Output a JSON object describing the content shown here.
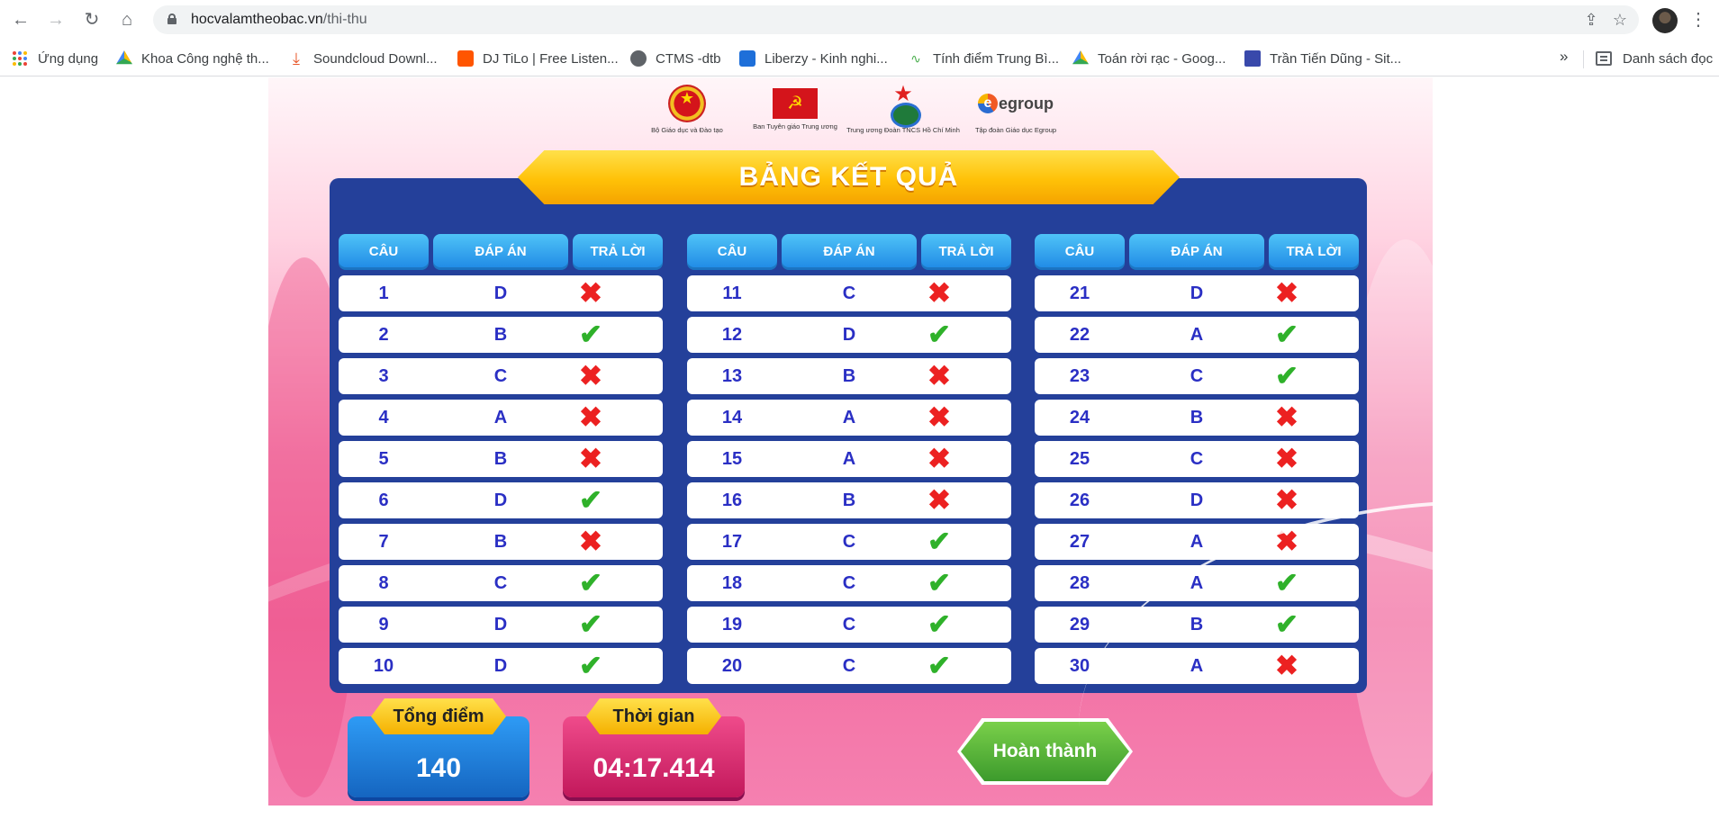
{
  "browser": {
    "url_domain": "hocvalamtheobac.vn",
    "url_path": "/thi-thu",
    "bookmarks": [
      {
        "label": "Ứng dụng",
        "icon": "apps-grid-icon"
      },
      {
        "label": "Khoa Công nghệ th...",
        "icon": "google-drive-icon"
      },
      {
        "label": "Soundcloud Downl...",
        "icon": "download-icon"
      },
      {
        "label": "DJ TiLo | Free Listen...",
        "icon": "soundcloud-icon"
      },
      {
        "label": "CTMS -dtb",
        "icon": "globe-icon"
      },
      {
        "label": "Liberzy - Kinh nghi...",
        "icon": "liberzy-icon"
      },
      {
        "label": "Tính điểm Trung Bì...",
        "icon": "calculator-icon"
      },
      {
        "label": "Toán rời rạc - Goog...",
        "icon": "google-drive-icon"
      },
      {
        "label": "Trần Tiến Dũng - Sit...",
        "icon": "sites-icon"
      }
    ],
    "more_label": "»",
    "reading_list_label": "Danh sách đọc"
  },
  "logos": [
    {
      "caption": "Bộ Giáo dục và Đào tạo"
    },
    {
      "caption": "Ban Tuyên giáo Trung ương"
    },
    {
      "caption": "Trung ương Đoàn TNCS Hồ Chí Minh"
    },
    {
      "caption": "Tập đoàn Giáo dục Egroup",
      "text": "egroup"
    }
  ],
  "results": {
    "title": "BẢNG KẾT QUẢ",
    "headers": {
      "question": "CÂU",
      "answer": "ĐÁP ÁN",
      "response": "TRẢ LỜI"
    },
    "rows": [
      {
        "q": "1",
        "a": "D",
        "correct": false
      },
      {
        "q": "2",
        "a": "B",
        "correct": true
      },
      {
        "q": "3",
        "a": "C",
        "correct": false
      },
      {
        "q": "4",
        "a": "A",
        "correct": false
      },
      {
        "q": "5",
        "a": "B",
        "correct": false
      },
      {
        "q": "6",
        "a": "D",
        "correct": true
      },
      {
        "q": "7",
        "a": "B",
        "correct": false
      },
      {
        "q": "8",
        "a": "C",
        "correct": true
      },
      {
        "q": "9",
        "a": "D",
        "correct": true
      },
      {
        "q": "10",
        "a": "D",
        "correct": true
      },
      {
        "q": "11",
        "a": "C",
        "correct": false
      },
      {
        "q": "12",
        "a": "D",
        "correct": true
      },
      {
        "q": "13",
        "a": "B",
        "correct": false
      },
      {
        "q": "14",
        "a": "A",
        "correct": false
      },
      {
        "q": "15",
        "a": "A",
        "correct": false
      },
      {
        "q": "16",
        "a": "B",
        "correct": false
      },
      {
        "q": "17",
        "a": "C",
        "correct": true
      },
      {
        "q": "18",
        "a": "C",
        "correct": true
      },
      {
        "q": "19",
        "a": "C",
        "correct": true
      },
      {
        "q": "20",
        "a": "C",
        "correct": true
      },
      {
        "q": "21",
        "a": "D",
        "correct": false
      },
      {
        "q": "22",
        "a": "A",
        "correct": true
      },
      {
        "q": "23",
        "a": "C",
        "correct": true
      },
      {
        "q": "24",
        "a": "B",
        "correct": false
      },
      {
        "q": "25",
        "a": "C",
        "correct": false
      },
      {
        "q": "26",
        "a": "D",
        "correct": false
      },
      {
        "q": "27",
        "a": "A",
        "correct": false
      },
      {
        "q": "28",
        "a": "A",
        "correct": true
      },
      {
        "q": "29",
        "a": "B",
        "correct": true
      },
      {
        "q": "30",
        "a": "A",
        "correct": false
      }
    ]
  },
  "summary": {
    "score_label": "Tổng điểm",
    "score_value": "140",
    "time_label": "Thời gian",
    "time_value": "04:17.414",
    "finish_label": "Hoàn thành"
  },
  "colors": {
    "board": "#24409a",
    "correct": "#2fb12a",
    "wrong": "#ec2121",
    "banner": "#ffc107",
    "answer_text": "#2a2fc4"
  }
}
